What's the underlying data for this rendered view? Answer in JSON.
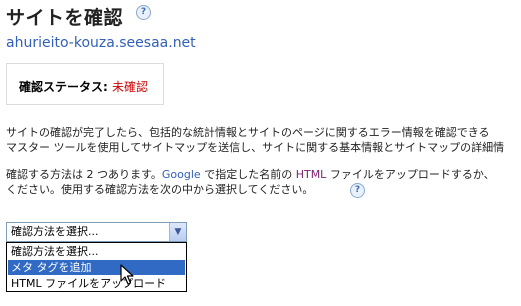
{
  "header": {
    "title": "サイトを確認",
    "help_glyph": "?",
    "site_url": "ahurieito-kouza.seesaa.net"
  },
  "status": {
    "label": "確認ステータス: ",
    "value": "未確認",
    "value_color": "#cc0000"
  },
  "description": {
    "line1": "サイトの確認が完了したら、包括的な統計情報とサイトのページに関するエラー情報を確認できる",
    "line2": "マスター ツールを使用してサイトマップを送信し、サイトに関する基本情報とサイトマップの詳細情"
  },
  "method_text": {
    "line1_a": "確認する方法は 2 つあります。",
    "line1_google": "Google",
    "line1_b": " で指定した名前の ",
    "line1_html": "HTML",
    "line1_c": " ファイルをアップロードするか、",
    "line2": "ください。使用する確認方法を次の中から選択してください。"
  },
  "select": {
    "selected": "確認方法を選択...",
    "arrow": "▼",
    "options": [
      {
        "label": "確認方法を選択..."
      },
      {
        "label": "メタ タグを追加"
      },
      {
        "label": "HTML ファイルをアップロード"
      }
    ],
    "highlighted_index": 1
  },
  "colors": {
    "link": "#3360b8",
    "highlight": "#316ac5"
  }
}
